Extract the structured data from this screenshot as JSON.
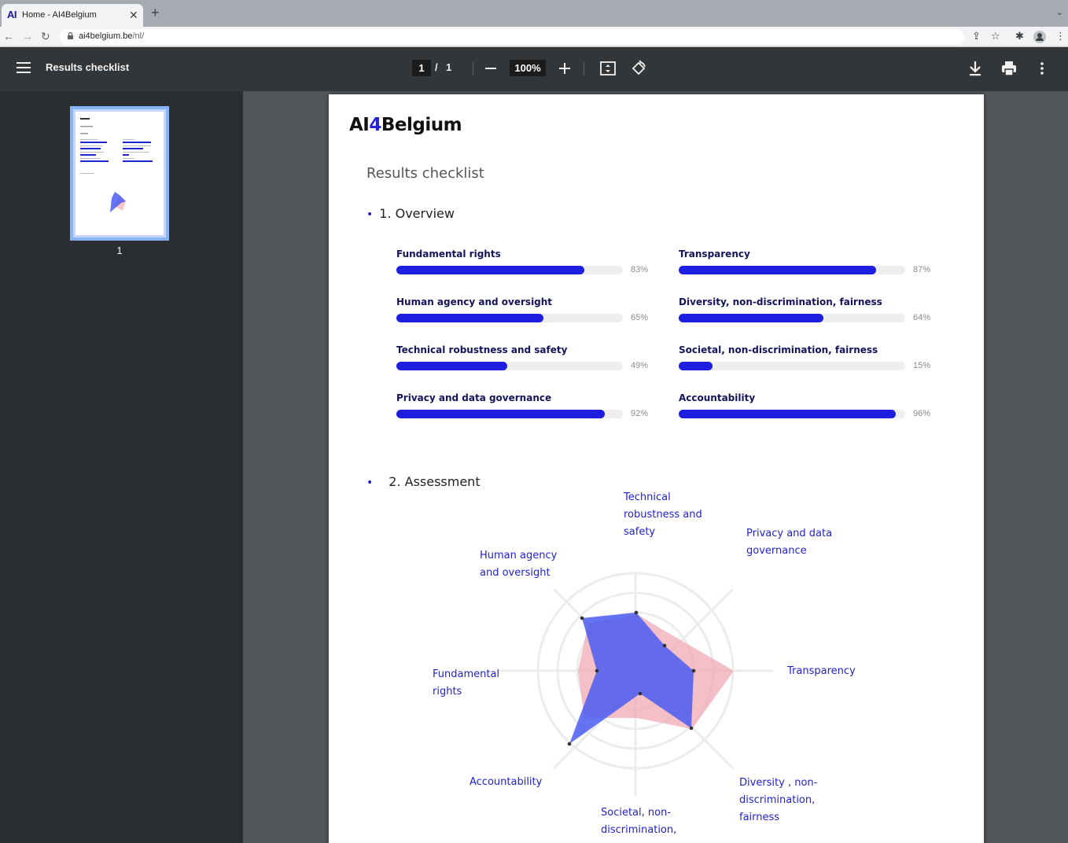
{
  "browser": {
    "tab_title": "Home - AI4Belgium",
    "tab_favicon": "AI",
    "url_host": "ai4belgium.be",
    "url_path": "/nl/"
  },
  "viewer": {
    "doc_title": "Results checklist",
    "page_current": "1",
    "page_separator": "/",
    "page_total": "1",
    "zoom": "100%",
    "thumbnail_label": "1"
  },
  "document": {
    "logo_text": "AI",
    "logo_digit": "4",
    "logo_rest": "Belgium",
    "title": "Results checklist",
    "overview_heading": "1. Overview",
    "assessment_heading": "2. Assessment",
    "metrics": [
      {
        "label": "Fundamental rights",
        "percent": 83,
        "percent_text": "83%"
      },
      {
        "label": "Transparency",
        "percent": 87,
        "percent_text": "87%"
      },
      {
        "label": "Human agency and oversight",
        "percent": 65,
        "percent_text": "65%"
      },
      {
        "label": "Diversity, non-discrimination, fairness",
        "percent": 64,
        "percent_text": "64%"
      },
      {
        "label": "Technical robustness and safety",
        "percent": 49,
        "percent_text": "49%"
      },
      {
        "label": "Societal, non-discrimination, fairness",
        "percent": 15,
        "percent_text": "15%"
      },
      {
        "label": "Privacy and data governance",
        "percent": 92,
        "percent_text": "92%"
      },
      {
        "label": "Accountability",
        "percent": 96,
        "percent_text": "96%"
      }
    ],
    "radar_labels": {
      "technical": "Technical robustness and safety",
      "privacy": "Privacy and data governance",
      "transparency": "Transparency",
      "diversity": "Diversity , non-discrimination, fairness",
      "societal": "Societal, non-discrimination,",
      "accountability": "Accountability",
      "fundamental": "Fundamental rights",
      "human": "Human agency and oversight"
    }
  },
  "colors": {
    "accent": "#1e1ee0",
    "radar_blue": "#4a5cf0",
    "radar_pink": "#f2a9b4",
    "toolbar": "#323639",
    "sidebar": "#2b2e31"
  },
  "icons": [
    "hamburger-icon",
    "download-icon",
    "print-icon",
    "more-vert-icon",
    "fit-page-icon",
    "rotate-icon",
    "lock-icon",
    "star-icon",
    "extensions-icon",
    "profile-icon"
  ]
}
